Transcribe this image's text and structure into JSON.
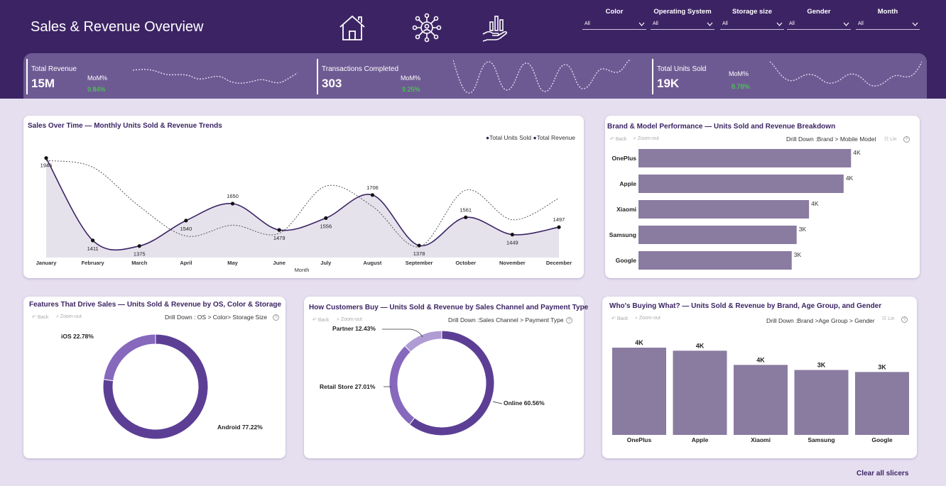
{
  "app": {
    "title": "Sales & Revenue Overview"
  },
  "nav": [
    {
      "icon": "home-icon"
    },
    {
      "icon": "network-person-icon"
    },
    {
      "icon": "hand-chart-icon"
    }
  ],
  "slicers": [
    {
      "label": "Color",
      "value": "All"
    },
    {
      "label": "Operating System",
      "value": "All"
    },
    {
      "label": "Storage size",
      "value": "All"
    },
    {
      "label": "Gender",
      "value": "All"
    },
    {
      "label": "Month",
      "value": "All"
    }
  ],
  "kpis": [
    {
      "name": "Total Revenue",
      "value": "15M",
      "mom_label": "MoM%",
      "mom_value": "9.84%"
    },
    {
      "name": "Transactions Completed",
      "value": "303",
      "mom_label": "MoM%",
      "mom_value": "9.25%"
    },
    {
      "name": "Total Units Sold",
      "value": "19K",
      "mom_label": "MoM%",
      "mom_value": "8.78%"
    }
  ],
  "colors": {
    "header": "#3c2464",
    "kpi_band": "#6e5a93",
    "bar": "#8a7ba1",
    "line": "#3c2464",
    "donut_dark": "#5c3f95",
    "donut_mid": "#8668bd",
    "donut_light": "#b09cd4",
    "positive": "#3ee63e"
  },
  "sales_over_time": {
    "title": "Sales Over Time — Monthly Units Sold & Revenue Trends",
    "legend": [
      "Total Units Sold",
      "Total Revenue"
    ],
    "xlabel": "Month"
  },
  "brand_model": {
    "title": "Brand & Model Performance — Units Sold and Revenue Breakdown",
    "back": "Back",
    "zoom": "Zoom-out",
    "drill": "Drill Down :Brand > Mobile Model",
    "lin": "Lin"
  },
  "features": {
    "title": "Features That Drive Sales — Units Sold & Revenue by OS, Color & Storage",
    "back": "Back",
    "zoom": "Zoom-out",
    "drill": "Drill Down : OS > Color> Storage Size"
  },
  "customers": {
    "title": "How Customers Buy — Units Sold & Revenue by Sales Channel and Payment Type",
    "back": "Back",
    "zoom": "Zoom-out",
    "drill": "Drill Down :Sales Channel > Payment Type"
  },
  "whos_buying": {
    "title": "Who's Buying What? — Units Sold & Revenue by Brand, Age Group, and Gender",
    "back": "Back",
    "zoom": "Zoom-out",
    "drill": "Drill Down :Brand >Age Group > Gender",
    "lin": "Lin"
  },
  "clear_slicers": "Clear all slicers",
  "chart_data": [
    {
      "type": "line",
      "title": "Sales Over Time — Monthly Units Sold & Revenue Trends",
      "xlabel": "Month",
      "categories": [
        "January",
        "February",
        "March",
        "April",
        "May",
        "June",
        "July",
        "August",
        "September",
        "October",
        "November",
        "December"
      ],
      "series": [
        {
          "name": "Total Units Sold",
          "values": [
            1946,
            1411,
            1375,
            1540,
            1650,
            1479,
            1556,
            1706,
            1378,
            1561,
            1449,
            1497
          ],
          "data_labels": [
            "1946",
            "1411",
            "1375",
            "1540",
            "1650",
            "1479",
            "1556",
            "1706",
            "1378",
            "1561",
            "1449",
            "1497"
          ]
        },
        {
          "name": "Total Revenue",
          "values": [
            1.42,
            1.37,
            1.08,
            0.86,
            0.94,
            0.88,
            1.23,
            1.08,
            0.78,
            1.2,
            0.98,
            1.14
          ]
        }
      ],
      "ylim": [
        1300,
        2000
      ]
    },
    {
      "type": "bar",
      "orientation": "horizontal",
      "categories": [
        "OnePlus",
        "Apple",
        "Xiaomi",
        "Samsung",
        "Google"
      ],
      "values": [
        4.3,
        4.15,
        3.45,
        3.2,
        3.1
      ],
      "data_labels": [
        "4K",
        "4K",
        "4K",
        "3K",
        "3K"
      ],
      "xlim": [
        0,
        5
      ]
    },
    {
      "type": "pie",
      "donut": true,
      "labels": [
        "Android",
        "iOS"
      ],
      "values": [
        77.22,
        22.78
      ],
      "data_labels": [
        "Android 77.22%",
        "iOS 22.78%"
      ]
    },
    {
      "type": "pie",
      "donut": true,
      "labels": [
        "Online",
        "Retail Store",
        "Partner"
      ],
      "values": [
        60.56,
        27.01,
        12.43
      ],
      "data_labels": [
        "Online 60.56%",
        "Retail Store 27.01%",
        "Partner 12.43%"
      ]
    },
    {
      "type": "bar",
      "categories": [
        "OnePlus",
        "Apple",
        "Xiaomi",
        "Samsung",
        "Google"
      ],
      "values": [
        4.3,
        4.15,
        3.45,
        3.2,
        3.1
      ],
      "data_labels": [
        "4K",
        "4K",
        "4K",
        "3K",
        "3K"
      ],
      "ylim": [
        0,
        5
      ]
    }
  ]
}
